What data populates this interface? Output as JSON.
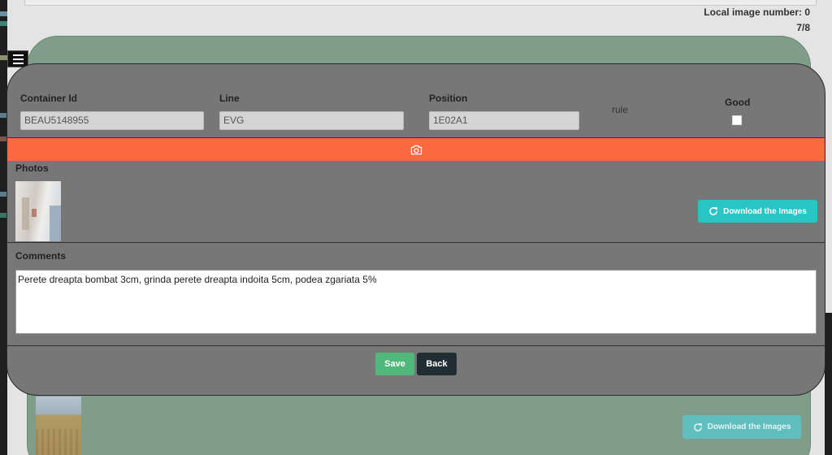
{
  "header": {
    "local_image_number": "Local image number: 0",
    "page_count": "7/8"
  },
  "icons": {
    "menu": "hamburger-menu-icon",
    "camera": "camera-icon",
    "refresh": "refresh-icon"
  },
  "form": {
    "container_id": {
      "label": "Container Id",
      "value": "BEAU5148955"
    },
    "line": {
      "label": "Line",
      "value": "EVG"
    },
    "position": {
      "label": "Position",
      "value": "1E02A1"
    },
    "rule": {
      "label": "rule"
    },
    "good": {
      "label": "Good",
      "checked": false
    }
  },
  "photos": {
    "label": "Photos",
    "download_label": "Download the Images"
  },
  "comments": {
    "label": "Comments",
    "value": "Perete dreapta bombat 3cm, grinda perete dreapta indoita 5cm, podea zgariata 5%"
  },
  "actions": {
    "save_label": "Save",
    "back_label": "Back"
  },
  "background_card": {
    "download_label": "Download the Images"
  },
  "colors": {
    "camera_bar": "#fe6a3f",
    "download_button": "#29c4c4",
    "save_button": "#50b87a",
    "back_button": "#222d33",
    "modal_bg": "#777777",
    "card_bg": "#7f9d88"
  }
}
